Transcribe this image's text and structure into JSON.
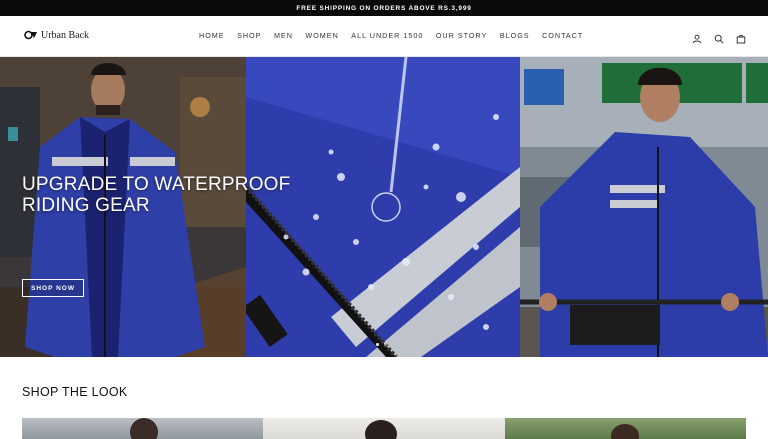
{
  "announcement": "FREE SHIPPING ON ORDERS ABOVE RS.3,999",
  "brand": {
    "name": "Urban Back"
  },
  "nav": [
    "HOME",
    "SHOP",
    "MEN",
    "WOMEN",
    "ALL UNDER 1500",
    "OUR STORY",
    "BLOGS",
    "CONTACT"
  ],
  "header_icons": [
    "account-icon",
    "search-icon",
    "cart-icon"
  ],
  "hero": {
    "title_line1": "UPGRADE TO WATERPROOF",
    "title_line2": "RIDING GEAR",
    "button": "SHOP NOW",
    "slides": 2,
    "active_slide": 1
  },
  "sections": {
    "shop_the_look": "SHOP THE LOOK"
  },
  "colors": {
    "accent": "#2b3bb0",
    "topbar": "#0a0a0a",
    "sign_green": "#1f6e3a"
  }
}
